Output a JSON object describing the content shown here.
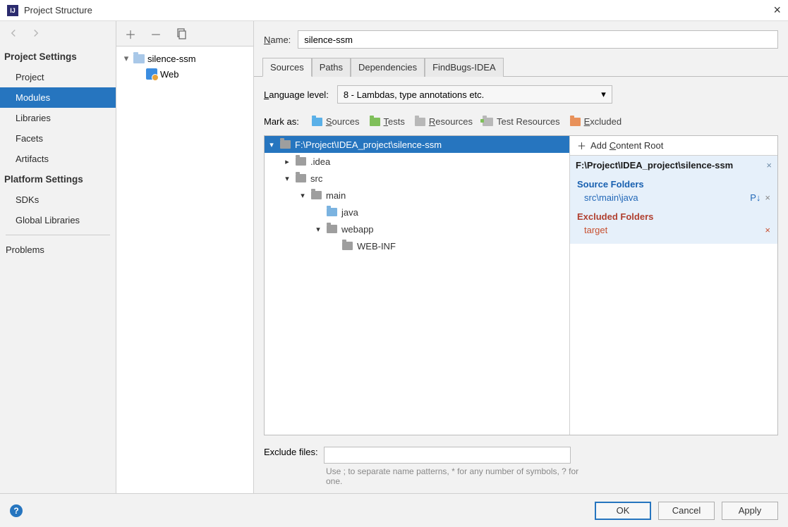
{
  "window": {
    "title": "Project Structure"
  },
  "leftNav": {
    "projectSettingsHeader": "Project Settings",
    "projectSettings": [
      "Project",
      "Modules",
      "Libraries",
      "Facets",
      "Artifacts"
    ],
    "platformSettingsHeader": "Platform Settings",
    "platformSettings": [
      "SDKs",
      "Global Libraries"
    ],
    "problems": "Problems"
  },
  "moduleTree": {
    "root": "silence-ssm",
    "child": "Web"
  },
  "nameRow": {
    "label_pre": "N",
    "label_post": "ame:",
    "value": "silence-ssm"
  },
  "tabs": [
    "Sources",
    "Paths",
    "Dependencies",
    "FindBugs-IDEA"
  ],
  "langLevel": {
    "label_pre": "L",
    "label_post": "anguage level:",
    "value": "8 - Lambdas, type annotations etc."
  },
  "markAs": {
    "label": "Mark as:",
    "sources_pre": "S",
    "sources_post": "ources",
    "tests_pre": "T",
    "tests_post": "ests",
    "resources_pre": "R",
    "resources_post": "esources",
    "testres": "Test Resources",
    "excluded_pre": "E",
    "excluded_post": "xcluded"
  },
  "contentTree": {
    "root": "F:\\Project\\IDEA_project\\silence-ssm",
    "items": [
      {
        "name": ".idea",
        "depth": 1,
        "expanded": false,
        "color": "gray"
      },
      {
        "name": "src",
        "depth": 1,
        "expanded": true,
        "color": "gray"
      },
      {
        "name": "main",
        "depth": 2,
        "expanded": true,
        "color": "gray"
      },
      {
        "name": "java",
        "depth": 3,
        "expanded": null,
        "color": "blue"
      },
      {
        "name": "webapp",
        "depth": 3,
        "expanded": true,
        "color": "gray"
      },
      {
        "name": "WEB-INF",
        "depth": 4,
        "expanded": null,
        "color": "gray"
      }
    ]
  },
  "rightInfo": {
    "addRoot_pre": "Add ",
    "addRoot_u": "C",
    "addRoot_post": "ontent Root",
    "rootPath": "F:\\Project\\IDEA_project\\silence-ssm",
    "sourceFoldersHeader": "Source Folders",
    "sourceFolders": [
      "src\\main\\java"
    ],
    "excludedFoldersHeader": "Excluded Folders",
    "excludedFolders": [
      "target"
    ]
  },
  "exclude": {
    "label": "Exclude files:",
    "value": "",
    "hint": "Use ; to separate name patterns, * for any number of symbols, ? for one."
  },
  "footer": {
    "ok": "OK",
    "cancel": "Cancel",
    "apply": "Apply"
  }
}
